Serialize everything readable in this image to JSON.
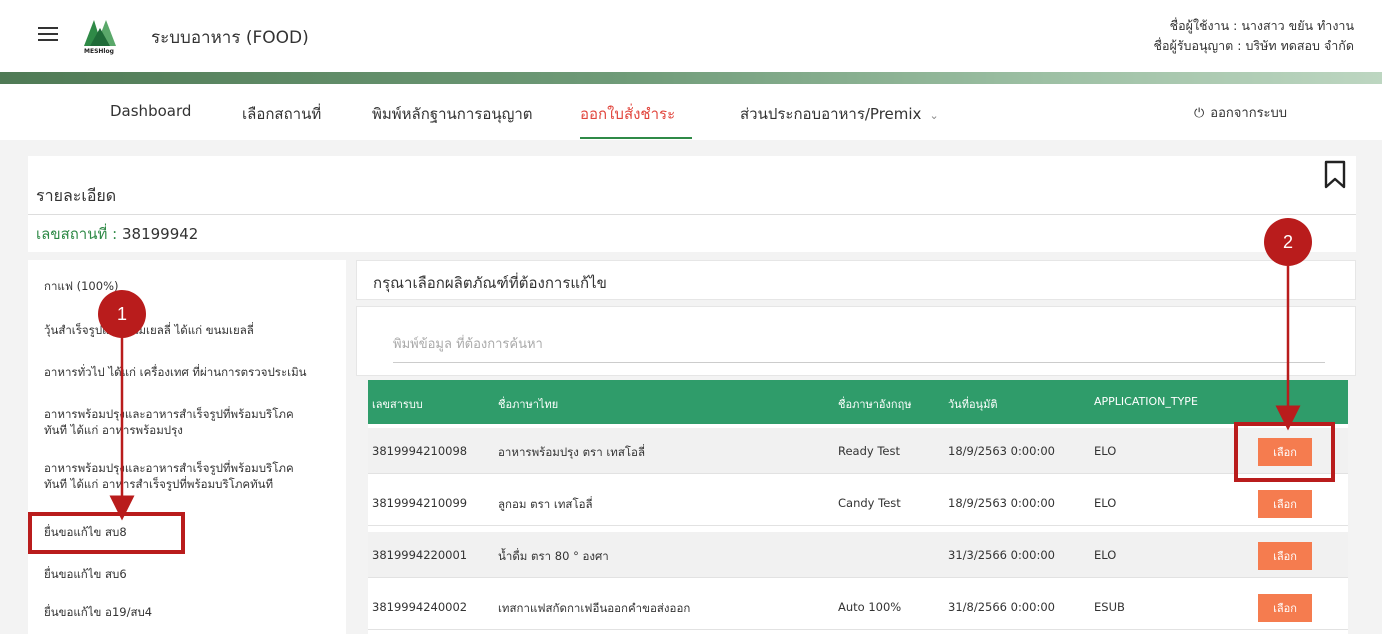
{
  "header": {
    "app_title": "ระบบอาหาร (FOOD)",
    "logo_text": "MESHlog",
    "user_line1": "ชื่อผู้ใช้งาน : นางสาว ขยัน ทำงาน",
    "user_line2": "ชื่อผู้รับอนุญาต : บริษัท ทดสอบ จำกัด"
  },
  "nav": {
    "items": [
      {
        "label": "Dashboard"
      },
      {
        "label": "เลือกสถานที่"
      },
      {
        "label": "พิมพ์หลักฐานการอนุญาต"
      },
      {
        "label": "ออกใบสั่งชำระ"
      },
      {
        "label": "ส่วนประกอบอาหาร/Premix"
      }
    ],
    "active": "ออกใบสั่งชำระ",
    "logout": "ออกจากระบบ"
  },
  "detail": {
    "title": "รายละเอียด",
    "location_label": "เลขสถานที่ :",
    "location_value": "38199942"
  },
  "sidebar": {
    "items": [
      {
        "label": "กาแฟ (100%)"
      },
      {
        "label": "วุ้นสำเร็จรูปและขนมเยลลี่ ได้แก่ ขนมเยลลี่"
      },
      {
        "label": "อาหารทั่วไป ได้แก่ เครื่องเทศ ที่ผ่านการตรวจประเมิน"
      },
      {
        "label": "อาหารพร้อมปรุงและอาหารสำเร็จรูปที่พร้อมบริโภค",
        "label2": "ทันที ได้แก่ อาหารพร้อมปรุง"
      },
      {
        "label": "อาหารพร้อมปรุงและอาหารสำเร็จรูปที่พร้อมบริโภค",
        "label2": "ทันที ได้แก่ อาหารสำเร็จรูปที่พร้อมบริโภคทันที"
      },
      {
        "label": "ยื่นขอแก้ไข สบ8"
      },
      {
        "label": "ยื่นขอแก้ไข สบ6"
      },
      {
        "label": "ยื่นขอแก้ไข อ19/สบ4"
      }
    ]
  },
  "main": {
    "panel_title": "กรุณาเลือกผลิตภัณฑ์ที่ต้องการแก้ไข",
    "search_placeholder": "พิมพ์ข้อมูล ที่ต้องการค้นหา",
    "table": {
      "headers": [
        "เลขสารบบ",
        "ชื่อภาษาไทย",
        "ชื่อภาษาอังกฤษ",
        "วันที่อนุมัติ",
        "APPLICATION_TYPE"
      ],
      "rows": [
        {
          "id": "3819994210098",
          "th": "อาหารพร้อมปรุง ตรา เทสโอลี่",
          "en": "Ready Test",
          "date": "18/9/2563 0:00:00",
          "type": "ELO",
          "btn": "เลือก"
        },
        {
          "id": "3819994210099",
          "th": "ลูกอม ตรา เทสโอลี่",
          "en": "Candy Test",
          "date": "18/9/2563 0:00:00",
          "type": "ELO",
          "btn": "เลือก"
        },
        {
          "id": "3819994220001",
          "th": "น้ำดื่ม ตรา 80 ° องศา",
          "en": "",
          "date": "31/3/2566 0:00:00",
          "type": "ELO",
          "btn": "เลือก"
        },
        {
          "id": "3819994240002",
          "th": "เทสกาแฟสกัดกาเฟอีนออกคำขอส่งออก",
          "en": "Auto 100%",
          "date": "31/8/2566 0:00:00",
          "type": "ESUB",
          "btn": "เลือก"
        }
      ]
    }
  },
  "annotations": {
    "step1": "1",
    "step2": "2"
  },
  "colors": {
    "brand_green": "#2f8a47",
    "table_header": "#2f9c6a",
    "active_nav": "#e1463d",
    "select_button": "#f57c4f",
    "annotation": "#b91c1c"
  },
  "icons": [
    "hamburger-icon",
    "logo-icon",
    "power-icon",
    "bookmark-icon",
    "chevron-down-icon"
  ]
}
